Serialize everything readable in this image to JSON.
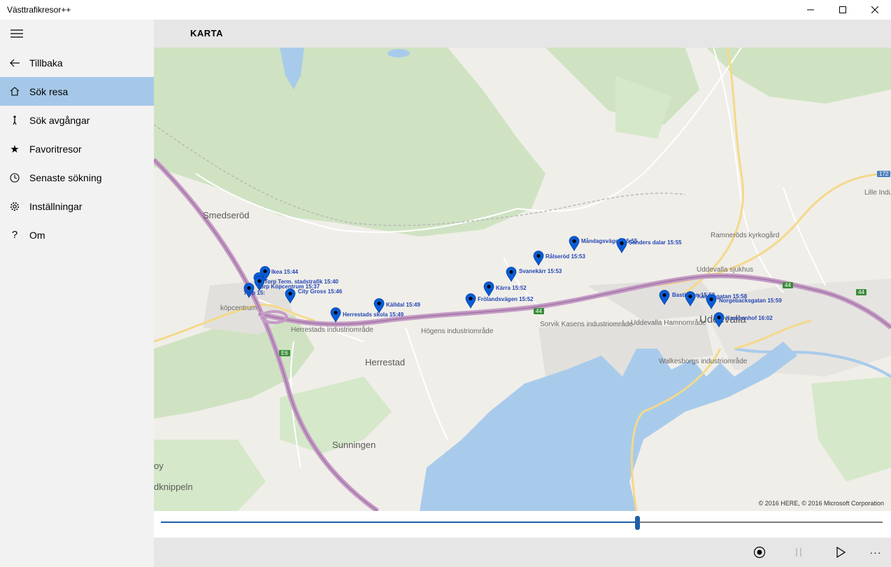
{
  "window": {
    "title": "Västtrafikresor++"
  },
  "sidebar": {
    "items": [
      {
        "label": "Tillbaka",
        "icon": "back-arrow-icon"
      },
      {
        "label": "Sök resa",
        "icon": "home-icon",
        "active": true
      },
      {
        "label": "Sök avgångar",
        "icon": "person-walking-icon"
      },
      {
        "label": "Favoritresor",
        "icon": "star-icon"
      },
      {
        "label": "Senaste sökning",
        "icon": "clock-icon"
      },
      {
        "label": "Inställningar",
        "icon": "gear-icon"
      },
      {
        "label": "Om",
        "icon": "question-icon"
      }
    ]
  },
  "header": {
    "title": "KARTA"
  },
  "map": {
    "places": [
      "Smedseröd",
      "köpcentrum",
      "Herrestads industriområde",
      "Herrestad",
      "Högens industriområde",
      "Sorvik Kasens industriområde",
      "Uddevalla Hamnområde",
      "Walkesborgs industriområde",
      "Uddevalla",
      "Uddevalla sjukhus",
      "Ramneröds kyrkogård",
      "Sunningen",
      "Lille Industrim",
      "oy",
      "dknippeln"
    ],
    "road_signs": [
      "E6",
      "44",
      "44",
      "44",
      "172"
    ],
    "stops": [
      "Ikea 15:44",
      "Torp Term. stadstrafik 15:40",
      "Torp Köpcentrum 15:37",
      "Torp 15:",
      "City Gross 15:46",
      "Herrestads skola 15:49",
      "Källdal 15:49",
      "Frölandsvägen 15:52",
      "Kärra 15:52",
      "Svanekärr 15:53",
      "Rålseröd 15:53",
      "Måndagsvägen 15:55",
      "Sanders dalar 15:55",
      "Bastionen 15:58",
      "Kaserngatan 15:58",
      "Norgebacksgatan 15:59",
      "Kampenhof 16:02"
    ],
    "copyright": "© 2016 HERE, © 2016 Microsoft Corporation"
  },
  "playback": {
    "progress_percent": 66
  },
  "commands": [
    {
      "name": "record-icon"
    },
    {
      "name": "pause-icon"
    },
    {
      "name": "play-icon"
    },
    {
      "name": "more-icon",
      "label": "···"
    }
  ],
  "colors": {
    "accent": "#1f5fa8",
    "active_nav": "#a6c8e8",
    "pin": "#0a5cd6",
    "stop_text": "#2346b5"
  }
}
